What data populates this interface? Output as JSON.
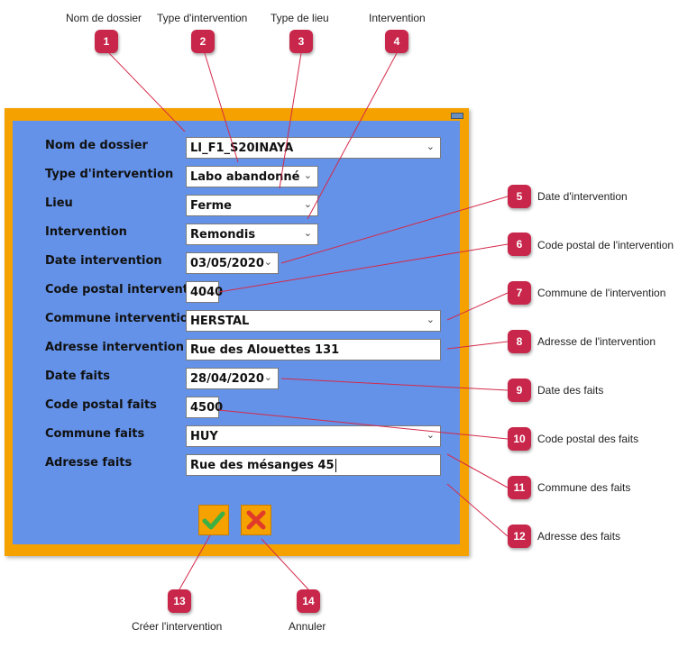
{
  "callouts": [
    {
      "num": "1",
      "text": "Nom de dossier"
    },
    {
      "num": "2",
      "text": "Type d'intervention"
    },
    {
      "num": "3",
      "text": "Type de lieu"
    },
    {
      "num": "4",
      "text": "Intervention"
    },
    {
      "num": "5",
      "text": "Date d'intervention"
    },
    {
      "num": "6",
      "text": "Code postal de l'intervention"
    },
    {
      "num": "7",
      "text": "Commune de l'intervention"
    },
    {
      "num": "8",
      "text": "Adresse de l'intervention"
    },
    {
      "num": "9",
      "text": "Date des faits"
    },
    {
      "num": "10",
      "text": "Code postal des faits"
    },
    {
      "num": "11",
      "text": "Commune des faits"
    },
    {
      "num": "12",
      "text": "Adresse des faits"
    },
    {
      "num": "13",
      "text": "Créer l'intervention"
    },
    {
      "num": "14",
      "text": "Annuler"
    }
  ],
  "form": {
    "nom_dossier": {
      "label": "Nom de dossier",
      "value": "LI_F1_S20INAYA"
    },
    "type_intervention": {
      "label": "Type d'intervention",
      "value": "Labo abandonné"
    },
    "lieu": {
      "label": "Lieu",
      "value": "Ferme"
    },
    "intervention": {
      "label": "Intervention",
      "value": "Remondis"
    },
    "date_intervention": {
      "label": "Date intervention",
      "value": "03/05/2020"
    },
    "code_postal_intervention": {
      "label": "Code postal intervention",
      "value": "4040"
    },
    "commune_intervention": {
      "label": "Commune intervention",
      "value": "HERSTAL"
    },
    "adresse_intervention": {
      "label": "Adresse intervention",
      "value": "Rue des Alouettes 131"
    },
    "date_faits": {
      "label": "Date faits",
      "value": "28/04/2020"
    },
    "code_postal_faits": {
      "label": "Code postal faits",
      "value": "4500"
    },
    "commune_faits": {
      "label": "Commune faits",
      "value": "HUY"
    },
    "adresse_faits": {
      "label": "Adresse faits",
      "value": "Rue des mésanges 45"
    }
  },
  "icons": {
    "dropdown": "chevron-down-icon",
    "confirm": "checkmark-icon",
    "cancel": "x-icon"
  },
  "colors": {
    "window_frame": "#f5a100",
    "window_bg": "#6492e8",
    "badge": "#c8264a",
    "callout_line": "#d42a4a",
    "confirm": "#3cb043",
    "cancel": "#e03a2a"
  }
}
